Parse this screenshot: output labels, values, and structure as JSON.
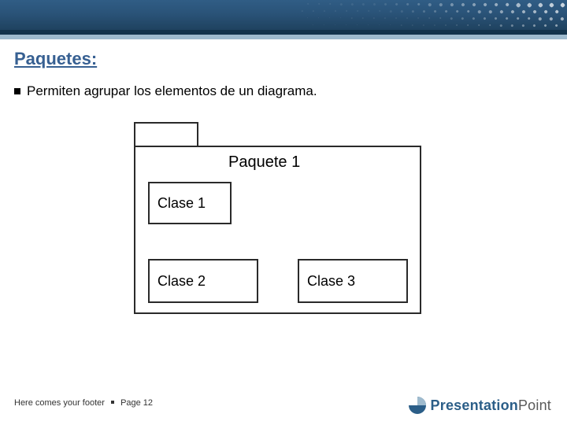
{
  "colors": {
    "accent": "#376092",
    "bandTop": "#305d85",
    "bandMid": "#2a5378",
    "bandBot": "#1f425f",
    "railDark": "#14344c",
    "railLight": "#9fbbce",
    "logoBlue": "#2b5e88",
    "logoGray": "#5a5a5a"
  },
  "title": "Paquetes:",
  "bullet": "Permiten agrupar los elementos de un diagrama.",
  "diagram": {
    "package_label": "Paquete 1",
    "class1": "Clase 1",
    "class2": "Clase 2",
    "class3": "Clase 3"
  },
  "footer": {
    "text": "Here comes your footer",
    "page_label": "Page 12"
  },
  "logo": {
    "word_a": "Presentation",
    "word_b": "Point"
  }
}
